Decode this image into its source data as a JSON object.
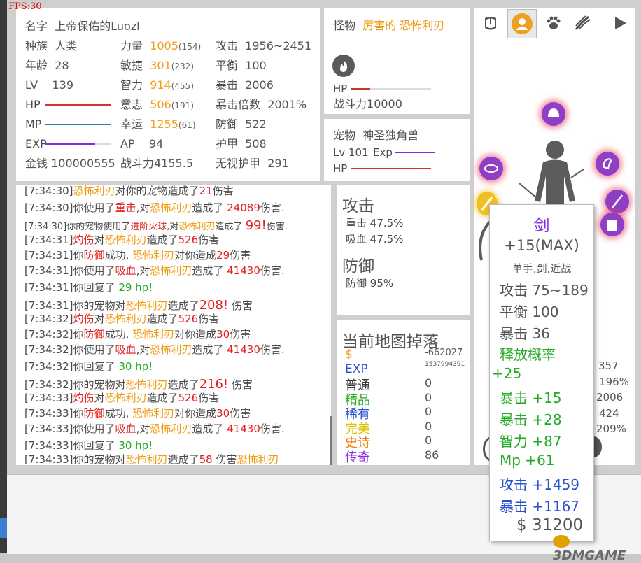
{
  "fps": "FPS:30",
  "player": {
    "name_label": "名字",
    "name": "上帝保佑的Luozl",
    "race_label": "种族",
    "race": "人类",
    "age_label": "年龄",
    "age": "28",
    "lv_label": "LV",
    "lv": "139",
    "hp_label": "HP",
    "mp_label": "MP",
    "exp_label": "EXP",
    "gold_label": "金钱",
    "gold": "100000555",
    "str_label": "力量",
    "str": "1005",
    "str_sub": "(154)",
    "agi_label": "敏捷",
    "agi": "301",
    "agi_sub": "(232)",
    "int_label": "智力",
    "int": "914",
    "int_sub": "(455)",
    "will_label": "意志",
    "will": "506",
    "will_sub": "(191)",
    "luck_label": "幸运",
    "luck": "1255",
    "luck_sub": "(61)",
    "ap_label": "AP",
    "ap": "94",
    "power_label": "战斗力",
    "power": "4155.5",
    "atk_label": "攻击",
    "atk": "1956~2451",
    "bal_label": "平衡",
    "bal": "100",
    "crit_label": "暴击",
    "crit": "2006",
    "critx_label": "暴击倍数",
    "critx": "2001%",
    "def_label": "防御",
    "def": "522",
    "armor_label": "护甲",
    "armor": "508",
    "ign_label": "无视护甲",
    "ign": "291",
    "hp_fill": 1.0,
    "mp_fill": 1.0,
    "exp_fill": 0.75
  },
  "monster": {
    "label": "怪物",
    "prefix": "厉害的",
    "name": "恐怖利刃",
    "hp_label": "HP",
    "hp_fill": 0.24,
    "power_label": "战斗力",
    "power": "10000"
  },
  "pet": {
    "label": "宠物",
    "name": "神圣独角兽",
    "lv_label": "Lv",
    "lv": "101",
    "exp_label": "Exp",
    "hp_label": "HP",
    "hp_fill": 1.0
  },
  "log": [
    {
      "time": "[7:34:30]",
      "parts": [
        [
          "",
          "n"
        ],
        [
          "恐怖利刃",
          "or"
        ],
        [
          "对你的宠物造成了",
          "n"
        ],
        [
          "21",
          "r"
        ],
        [
          "伤害",
          "n"
        ]
      ]
    },
    {
      "time": "[7:34:30]",
      "parts": [
        [
          "你使用了",
          "n"
        ],
        [
          "重击",
          "r"
        ],
        [
          ",对",
          "n"
        ],
        [
          "恐怖利刃",
          "or"
        ],
        [
          "造成了 ",
          "n"
        ],
        [
          "24089",
          "r"
        ],
        [
          "伤害.",
          "n"
        ]
      ]
    },
    {
      "time": "[7:34:30]",
      "parts": [
        [
          "你的宠物使用了",
          "n"
        ],
        [
          "进阶火球",
          "r"
        ],
        [
          ",对",
          "n"
        ],
        [
          "恐怖利刃",
          "or"
        ],
        [
          "造成了 ",
          "n"
        ],
        [
          "99!",
          "rb"
        ],
        [
          "伤害.",
          "n"
        ]
      ]
    },
    {
      "time": "[7:34:31]",
      "parts": [
        [
          "灼伤",
          "r"
        ],
        [
          "对",
          "n"
        ],
        [
          "恐怖利刃",
          "or"
        ],
        [
          "造成了",
          "n"
        ],
        [
          "526",
          "r"
        ],
        [
          "伤害",
          "n"
        ]
      ]
    },
    {
      "time": "[7:34:31]",
      "parts": [
        [
          "你",
          "n"
        ],
        [
          "防御",
          "r"
        ],
        [
          "成功, ",
          "n"
        ],
        [
          "恐怖利刃",
          "or"
        ],
        [
          "对你造成",
          "n"
        ],
        [
          "29",
          "r"
        ],
        [
          "伤害",
          "n"
        ]
      ]
    },
    {
      "time": "[7:34:31]",
      "parts": [
        [
          "你使用了",
          "n"
        ],
        [
          "吸血",
          "r"
        ],
        [
          ",对",
          "n"
        ],
        [
          "恐怖利刃",
          "or"
        ],
        [
          "造成了 ",
          "n"
        ],
        [
          "41430",
          "r"
        ],
        [
          "伤害.",
          "n"
        ]
      ]
    },
    {
      "time": "[7:34:31]",
      "parts": [
        [
          "你回复了 ",
          "n"
        ],
        [
          "29 hp!",
          "g"
        ]
      ]
    },
    {
      "time": "[7:34:31]",
      "parts": [
        [
          "你的宠物对",
          "n"
        ],
        [
          "恐怖利刃",
          "or"
        ],
        [
          "造成了",
          "n"
        ],
        [
          "208!",
          "rb"
        ],
        [
          " 伤害",
          "n"
        ]
      ]
    },
    {
      "time": "[7:34:32]",
      "parts": [
        [
          "灼伤",
          "r"
        ],
        [
          "对",
          "n"
        ],
        [
          "恐怖利刃",
          "or"
        ],
        [
          "造成了",
          "n"
        ],
        [
          "526",
          "r"
        ],
        [
          "伤害",
          "n"
        ]
      ]
    },
    {
      "time": "[7:34:32]",
      "parts": [
        [
          "你",
          "n"
        ],
        [
          "防御",
          "r"
        ],
        [
          "成功, ",
          "n"
        ],
        [
          "恐怖利刃",
          "or"
        ],
        [
          "对你造成",
          "n"
        ],
        [
          "30",
          "r"
        ],
        [
          "伤害",
          "n"
        ]
      ]
    },
    {
      "time": "[7:34:32]",
      "parts": [
        [
          "你使用了",
          "n"
        ],
        [
          "吸血",
          "r"
        ],
        [
          ",对",
          "n"
        ],
        [
          "恐怖利刃",
          "or"
        ],
        [
          "造成了 ",
          "n"
        ],
        [
          "41430",
          "r"
        ],
        [
          "伤害.",
          "n"
        ]
      ]
    },
    {
      "time": "[7:34:32]",
      "parts": [
        [
          "你回复了 ",
          "n"
        ],
        [
          "30 hp!",
          "g"
        ]
      ]
    },
    {
      "time": "[7:34:32]",
      "parts": [
        [
          "你的宠物对",
          "n"
        ],
        [
          "恐怖利刃",
          "or"
        ],
        [
          "造成了",
          "n"
        ],
        [
          "216!",
          "rb"
        ],
        [
          " 伤害",
          "n"
        ]
      ]
    },
    {
      "time": "[7:34:33]",
      "parts": [
        [
          "灼伤",
          "r"
        ],
        [
          "对",
          "n"
        ],
        [
          "恐怖利刃",
          "or"
        ],
        [
          "造成了",
          "n"
        ],
        [
          "526",
          "r"
        ],
        [
          "伤害",
          "n"
        ]
      ]
    },
    {
      "time": "[7:34:33]",
      "parts": [
        [
          "你",
          "n"
        ],
        [
          "防御",
          "r"
        ],
        [
          "成功, ",
          "n"
        ],
        [
          "恐怖利刃",
          "or"
        ],
        [
          "对你造成",
          "n"
        ],
        [
          "30",
          "r"
        ],
        [
          "伤害",
          "n"
        ]
      ]
    },
    {
      "time": "[7:34:33]",
      "parts": [
        [
          "你使用了",
          "n"
        ],
        [
          "吸血",
          "r"
        ],
        [
          ",对",
          "n"
        ],
        [
          "恐怖利刃",
          "or"
        ],
        [
          "造成了 ",
          "n"
        ],
        [
          "41430",
          "r"
        ],
        [
          "伤害.",
          "n"
        ]
      ]
    },
    {
      "time": "[7:34:33]",
      "parts": [
        [
          "你回复了 ",
          "n"
        ],
        [
          "30 hp!",
          "g"
        ]
      ]
    },
    {
      "time": "[7:34:33]",
      "parts": [
        [
          "你的宠物对",
          "n"
        ],
        [
          "恐怖利刃",
          "or"
        ],
        [
          "造成了",
          "n"
        ],
        [
          "58",
          "r"
        ],
        [
          " 伤害",
          "n"
        ],
        [
          "恐怖利刃",
          "or"
        ]
      ]
    }
  ],
  "battle": {
    "attack_title": "攻击",
    "heavy_label": "重击",
    "heavy": "47.5%",
    "drain_label": "吸血",
    "drain": "47.5%",
    "defense_title": "防御",
    "def_label": "防御",
    "def": "95%"
  },
  "drops": {
    "title": "当前地图掉落",
    "gold_sym": "$",
    "gold": "-662027",
    "exp_label": "EXP",
    "exp": "1537994391",
    "rows": [
      {
        "label": "普通",
        "value": "0",
        "color": "#3a3a3a"
      },
      {
        "label": "精品",
        "value": "0",
        "color": "#22aa22"
      },
      {
        "label": "稀有",
        "value": "0",
        "color": "#2a50d0"
      },
      {
        "label": "完美",
        "value": "0",
        "color": "#e0c000"
      },
      {
        "label": "史诗",
        "value": "0",
        "color": "#f07a00"
      },
      {
        "label": "传奇",
        "value": "86",
        "color": "#8a2be2"
      }
    ]
  },
  "right_partial": [
    "357",
    "196%",
    "2006",
    "424",
    "209%"
  ],
  "tooltip": {
    "name": "剑",
    "level": "+15(MAX)",
    "type": "单手,剑,近战",
    "atk_label": "攻击",
    "atk": "75~189",
    "bal_label": "平衡",
    "bal": "100",
    "crit_label": "暴击",
    "crit": "36",
    "proc_label": "释放概率",
    "proc": "+25",
    "bonuses": [
      {
        "label": "暴击",
        "value": "+15",
        "color": "#22aa22"
      },
      {
        "label": "暴击",
        "value": "+28",
        "color": "#22aa22"
      },
      {
        "label": "智力",
        "value": "+87",
        "color": "#22aa22"
      },
      {
        "label": "Mp",
        "value": "+61",
        "color": "#22aa22"
      },
      {
        "label": "攻击",
        "value": "+1459",
        "color": "#2a50d0"
      },
      {
        "label": "暴击",
        "value": "+1167",
        "color": "#2a50d0"
      }
    ],
    "price": "$ 31200"
  },
  "watermark": "3DMGAME",
  "icons": [
    "chest-icon",
    "character-icon",
    "paw-icon",
    "claw-icon",
    "play-icon",
    "fire-icon"
  ],
  "colors": {
    "hp": "#d93030",
    "mp": "#2a7fb0",
    "exp": "#8a2be2",
    "gold": "#f0a020",
    "accent": "#8f3fc6"
  }
}
